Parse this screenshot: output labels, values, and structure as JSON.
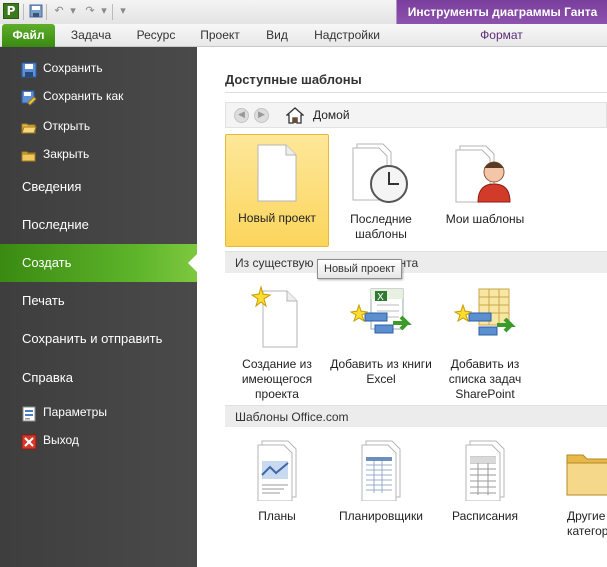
{
  "window": {
    "app_icon_letter": "P",
    "contextual_group": "Инструменты диаграммы Ганта"
  },
  "qat": {
    "icons": [
      "save-icon",
      "undo-icon",
      "redo-icon",
      "customize-icon"
    ]
  },
  "ribbon": {
    "tabs": [
      {
        "label": "Файл"
      },
      {
        "label": "Задача"
      },
      {
        "label": "Ресурс"
      },
      {
        "label": "Проект"
      },
      {
        "label": "Вид"
      },
      {
        "label": "Надстройки"
      },
      {
        "label": "Формат"
      }
    ]
  },
  "nav": {
    "items": [
      {
        "label": "Сохранить",
        "icon": "save-icon"
      },
      {
        "label": "Сохранить как",
        "icon": "save-as-icon"
      },
      {
        "label": "Открыть",
        "icon": "open-folder-icon"
      },
      {
        "label": "Закрыть",
        "icon": "close-folder-icon"
      },
      {
        "label": "Сведения"
      },
      {
        "label": "Последние"
      },
      {
        "label": "Создать",
        "selected": true
      },
      {
        "label": "Печать"
      },
      {
        "label": "Сохранить и отправить"
      },
      {
        "label": "Справка"
      },
      {
        "label": "Параметры",
        "icon": "options-icon"
      },
      {
        "label": "Выход",
        "icon": "exit-icon"
      }
    ]
  },
  "main": {
    "title": "Доступные шаблоны",
    "breadcrumb": "Домой",
    "top_tiles": [
      {
        "label": "Новый проект",
        "icon": "blank-document-icon",
        "selected": true
      },
      {
        "label": "Последние шаблоны",
        "icon": "recent-templates-icon"
      },
      {
        "label": "Мои шаблоны",
        "icon": "my-templates-icon"
      }
    ],
    "section_existing": {
      "label_visible_left": "Из существую",
      "label_visible_right": "нта"
    },
    "existing_tiles": [
      {
        "label": "Создание из имеющегося проекта",
        "icon": "new-from-existing-icon"
      },
      {
        "label": "Добавить из книги Excel",
        "icon": "excel-import-icon"
      },
      {
        "label": "Добавить из списка задач SharePoint",
        "icon": "sharepoint-import-icon"
      }
    ],
    "section_office": "Шаблоны Office.com",
    "office_tiles": [
      {
        "label": "Планы",
        "icon": "plans-icon"
      },
      {
        "label": "Планировщики",
        "icon": "planners-icon"
      },
      {
        "label": "Расписания",
        "icon": "schedules-icon"
      },
      {
        "label": "Другие категори",
        "icon": "folder-icon"
      }
    ],
    "tooltip": "Новый проект"
  },
  "colors": {
    "file_tab_green": "#3a8a12",
    "nav_bg": "#444444",
    "selected_tile": "#fbd55c",
    "context_purple": "#7a3f9c"
  }
}
